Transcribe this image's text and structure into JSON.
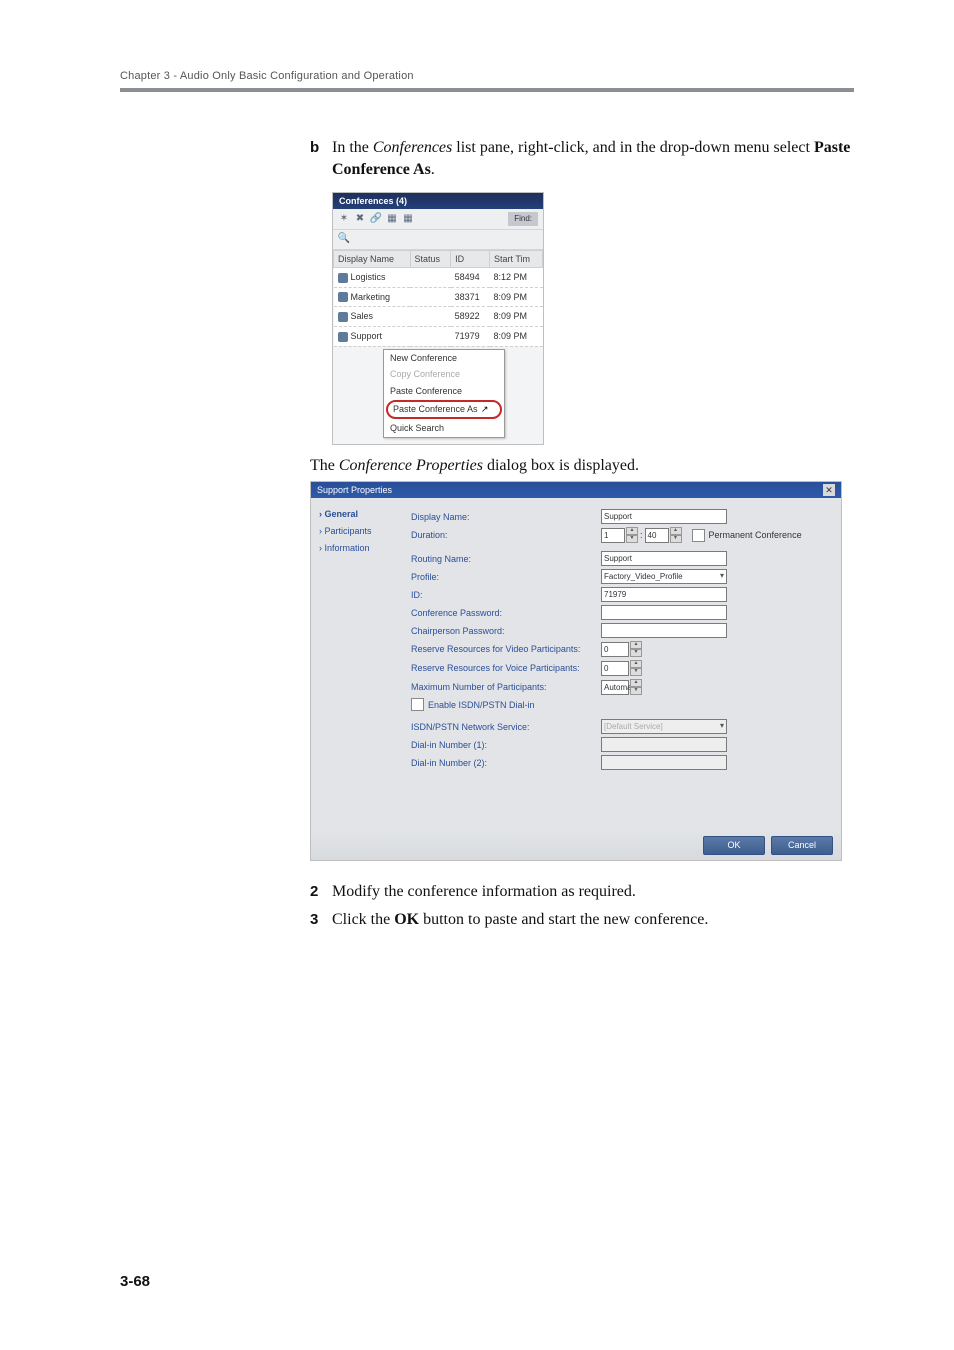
{
  "chapter_line": "Chapter 3 - Audio Only Basic Configuration and Operation",
  "steps": {
    "b": {
      "num": "b",
      "text_before": "In the ",
      "em1": "Conferences",
      "text_mid": " list pane, right-click, and in the drop-down menu select ",
      "bold": "Paste Conference As",
      "text_after": "."
    },
    "s2": {
      "num": "2",
      "text": "Modify the conference information as required."
    },
    "s3": {
      "num": "3",
      "text_before": "Click the ",
      "bold": "OK",
      "text_after": " button to paste and start the new conference."
    }
  },
  "caption1": {
    "before": "The ",
    "em": "Conference Properties",
    "after": " dialog box is displayed."
  },
  "shot1": {
    "title": "Conferences (4)",
    "find_label": "Find:",
    "headers": {
      "name": "Display Name",
      "status": "Status",
      "id": "ID",
      "start": "Start Tim"
    },
    "rows": [
      {
        "name": "Logistics",
        "status": "",
        "id": "58494",
        "start": "8:12 PM"
      },
      {
        "name": "Marketing",
        "status": "",
        "id": "38371",
        "start": "8:09 PM"
      },
      {
        "name": "Sales",
        "status": "",
        "id": "58922",
        "start": "8:09 PM"
      },
      {
        "name": "Support",
        "status": "",
        "id": "71979",
        "start": "8:09 PM"
      }
    ],
    "menu": {
      "new": "New Conference",
      "copy": "Copy Conference",
      "paste": "Paste Conference",
      "paste_as": "Paste Conference As",
      "quick": "Quick Search"
    }
  },
  "shot2": {
    "title": "Support Properties",
    "side": {
      "general": "General",
      "participants": "Participants",
      "information": "Information"
    },
    "labels": {
      "display_name": "Display Name:",
      "duration": "Duration:",
      "perm": "Permanent Conference",
      "routing": "Routing Name:",
      "profile": "Profile:",
      "id": "ID:",
      "conf_pw": "Conference Password:",
      "chair_pw": "Chairperson Password:",
      "res_video": "Reserve Resources for Video Participants:",
      "res_voice": "Reserve Resources for Voice Participants:",
      "max_part": "Maximum Number of Participants:",
      "enable_isdn": "Enable ISDN/PSTN Dial-in",
      "isdn_service": "ISDN/PSTN Network Service:",
      "dial1": "Dial-in Number (1):",
      "dial2": "Dial-in Number (2):"
    },
    "values": {
      "display_name": "Support",
      "dur_h": "1",
      "dur_m": "40",
      "routing": "Support",
      "profile": "Factory_Video_Profile",
      "id": "71979",
      "res_video": "0",
      "res_voice": "0",
      "max_part": "Automatic",
      "isdn_service": "[Default Service]"
    },
    "buttons": {
      "ok": "OK",
      "cancel": "Cancel"
    }
  },
  "page_number": "3-68"
}
